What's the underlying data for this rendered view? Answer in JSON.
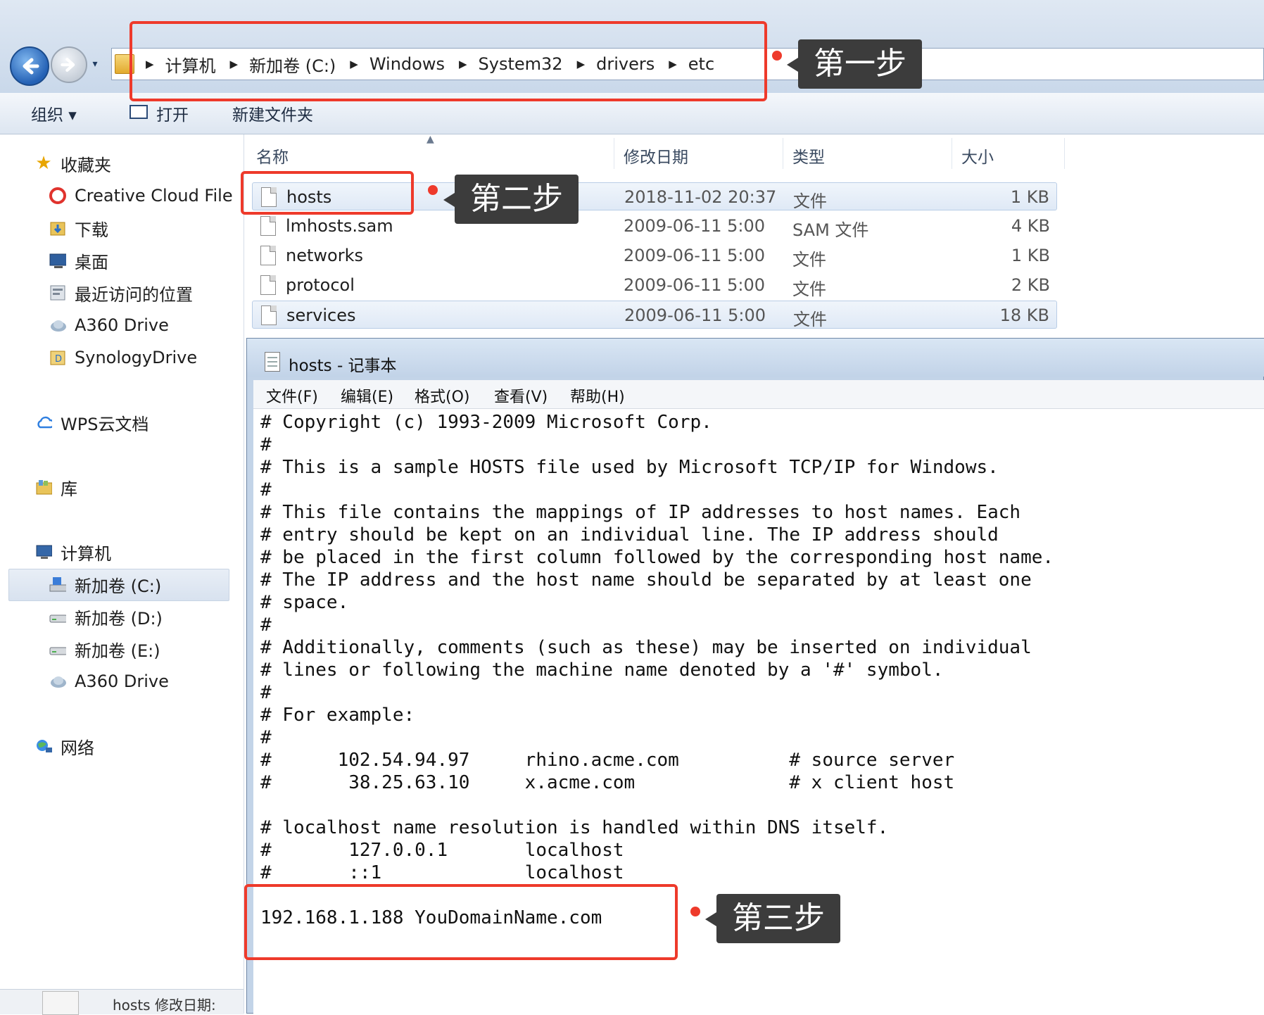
{
  "address": {
    "crumbs": [
      "计算机",
      "新加卷 (C:)",
      "Windows",
      "System32",
      "drivers",
      "etc"
    ]
  },
  "toolbar": {
    "organize": "组织 ▾",
    "open": "打开",
    "new_folder": "新建文件夹"
  },
  "sidebar": {
    "favorites": "收藏夹",
    "creative_cloud": "Creative Cloud File",
    "downloads": "下载",
    "desktop": "桌面",
    "recent": "最近访问的位置",
    "a360_fav": "A360 Drive",
    "synology": "SynologyDrive",
    "wps": "WPS云文档",
    "library": "库",
    "computer": "计算机",
    "drive_c": "新加卷 (C:)",
    "drive_d": "新加卷 (D:)",
    "drive_e": "新加卷 (E:)",
    "a360_comp": "A360 Drive",
    "network": "网络"
  },
  "status": {
    "file": "hosts 修改日期:"
  },
  "columns": {
    "name": "名称",
    "date": "修改日期",
    "type": "类型",
    "size": "大小"
  },
  "files": [
    {
      "name": "hosts",
      "date": "2018-11-02 20:37",
      "type": "文件",
      "size": "1 KB"
    },
    {
      "name": "lmhosts.sam",
      "date": "2009-06-11 5:00",
      "type": "SAM 文件",
      "size": "4 KB"
    },
    {
      "name": "networks",
      "date": "2009-06-11 5:00",
      "type": "文件",
      "size": "1 KB"
    },
    {
      "name": "protocol",
      "date": "2009-06-11 5:00",
      "type": "文件",
      "size": "2 KB"
    },
    {
      "name": "services",
      "date": "2009-06-11 5:00",
      "type": "文件",
      "size": "18 KB"
    }
  ],
  "notepad": {
    "title": "hosts - 记事本",
    "menu": {
      "file": "文件(F)",
      "edit": "编辑(E)",
      "format": "格式(O)",
      "view": "查看(V)",
      "help": "帮助(H)"
    },
    "content": "# Copyright (c) 1993-2009 Microsoft Corp.\n#\n# This is a sample HOSTS file used by Microsoft TCP/IP for Windows.\n#\n# This file contains the mappings of IP addresses to host names. Each\n# entry should be kept on an individual line. The IP address should\n# be placed in the first column followed by the corresponding host name.\n# The IP address and the host name should be separated by at least one\n# space.\n#\n# Additionally, comments (such as these) may be inserted on individual\n# lines or following the machine name denoted by a '#' symbol.\n#\n# For example:\n#\n#      102.54.94.97     rhino.acme.com          # source server\n#       38.25.63.10     x.acme.com              # x client host\n\n# localhost name resolution is handled within DNS itself.\n#\t127.0.0.1       localhost\n#\t::1             localhost\n\n192.168.1.188 YouDomainName.com"
  },
  "annotations": {
    "step1": "第一步",
    "step2": "第二步",
    "step3": "第三步",
    "color": "#ee3a2b"
  }
}
